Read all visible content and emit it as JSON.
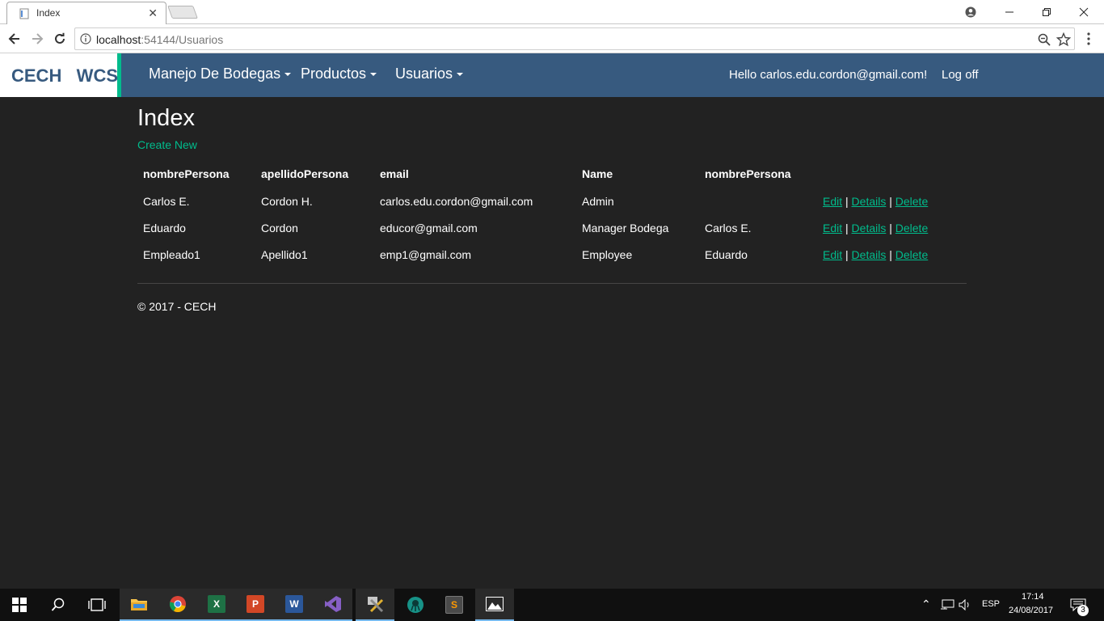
{
  "browser": {
    "tab_title": "Index",
    "url_host": "localhost",
    "url_path": ":54144/Usuarios"
  },
  "navbar": {
    "brand": "CECH   WCS",
    "menus": [
      {
        "label": "Manejo De Bodegas"
      },
      {
        "label": "Productos"
      },
      {
        "label": "Usuarios"
      }
    ],
    "greeting": "Hello carlos.edu.cordon@gmail.com!",
    "logoff": "Log off",
    "colors": {
      "navbar": "#375a7f",
      "accent": "#00bc8c",
      "page_bg": "#222222"
    }
  },
  "page": {
    "title": "Index",
    "create_new": "Create New",
    "footer": "© 2017 - CECH"
  },
  "table": {
    "headers": [
      "nombrePersona",
      "apellidoPersona",
      "email",
      "Name",
      "nombrePersona",
      ""
    ],
    "rows": [
      {
        "nombre": "Carlos E.",
        "apellido": "Cordon H.",
        "email": "carlos.edu.cordon@gmail.com",
        "role": "Admin",
        "jefe": ""
      },
      {
        "nombre": "Eduardo",
        "apellido": "Cordon",
        "email": "educor@gmail.com",
        "role": "Manager Bodega",
        "jefe": "Carlos E."
      },
      {
        "nombre": "Empleado1",
        "apellido": "Apellido1",
        "email": "emp1@gmail.com",
        "role": "Employee",
        "jefe": "Eduardo"
      }
    ],
    "actions": {
      "edit": "Edit",
      "details": "Details",
      "delete": "Delete",
      "separator": "|"
    }
  },
  "taskbar": {
    "apps": [
      "start-icon",
      "search-icon",
      "task-view-icon",
      "file-explorer-icon",
      "chrome-icon",
      "excel-icon",
      "powerpoint-icon",
      "word-icon",
      "visual-studio-icon",
      "tools-icon",
      "gitkraken-icon",
      "sublime-icon",
      "photos-icon"
    ],
    "language": "ESP",
    "time": "17:14",
    "date": "24/08/2017",
    "notifications": "3"
  }
}
